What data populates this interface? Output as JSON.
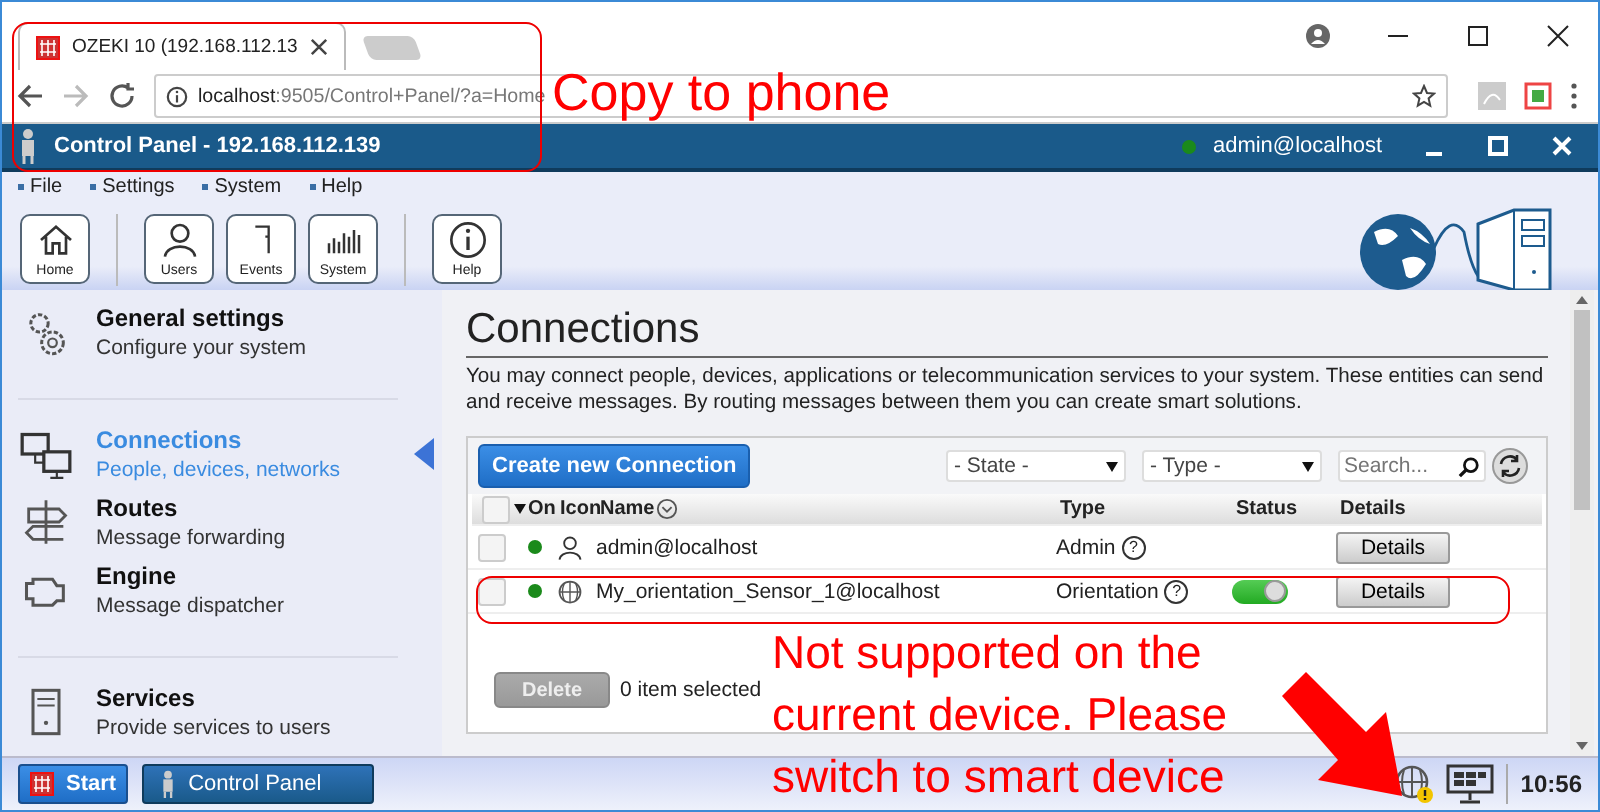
{
  "browser": {
    "tab_title": "OZEKI 10 (192.168.112.13",
    "url_host": "localhost",
    "url_rest": ":9505/Control+Panel/?a=Home"
  },
  "app": {
    "title": "Control Panel - 192.168.112.139",
    "user": "admin@localhost",
    "online": true
  },
  "menu": [
    "File",
    "Settings",
    "System",
    "Help"
  ],
  "toolbar": [
    [
      {
        "label": "Home"
      }
    ],
    [
      {
        "label": "Users"
      },
      {
        "label": "Events"
      },
      {
        "label": "System"
      }
    ],
    [
      {
        "label": "Help"
      }
    ]
  ],
  "sidebar": [
    [
      {
        "title": "General settings",
        "subtitle": "Configure your system",
        "selected": false
      }
    ],
    [
      {
        "title": "Connections",
        "subtitle": "People, devices, networks",
        "selected": true
      },
      {
        "title": "Routes",
        "subtitle": "Message forwarding",
        "selected": false
      },
      {
        "title": "Engine",
        "subtitle": "Message dispatcher",
        "selected": false
      }
    ],
    [
      {
        "title": "Services",
        "subtitle": "Provide services to users",
        "selected": false
      }
    ]
  ],
  "main": {
    "heading": "Connections",
    "description": "You may connect people, devices, applications or telecommunication services to your system. These entities can send and receive messages. By routing messages between them you can create smart solutions.",
    "create_button": "Create new Connection",
    "state_filter": "- State -",
    "type_filter": "- Type -",
    "search": {
      "placeholder": "Search..."
    },
    "table": {
      "select_all_checked": false,
      "columns": [
        "On",
        "Icon",
        "Name",
        "Type",
        "Status",
        "Details"
      ],
      "rows": [
        {
          "checked": false,
          "on": true,
          "kind": "user",
          "name": "admin@localhost",
          "type": "Admin",
          "help": "?",
          "details": "Details"
        },
        {
          "checked": false,
          "on": true,
          "kind": "sensor",
          "name": "My_orientation_Sensor_1@localhost",
          "type": "Orientation",
          "help": "?",
          "switch_on": true,
          "details": "Details"
        }
      ]
    },
    "delete_button": {
      "label": "Delete",
      "disabled": true
    },
    "selection_count": "0 item selected"
  },
  "taskbar": {
    "start": "Start",
    "app": "Control Panel",
    "time": "10:56"
  },
  "annotations": [
    {
      "kind": "box"
    },
    {
      "kind": "text",
      "lines": [
        "Copy to phone"
      ]
    },
    {
      "kind": "box"
    },
    {
      "kind": "text",
      "lines": [
        "Not supported on the",
        "current device. Please",
        "switch to smart device"
      ]
    },
    {
      "kind": "arrow"
    }
  ]
}
